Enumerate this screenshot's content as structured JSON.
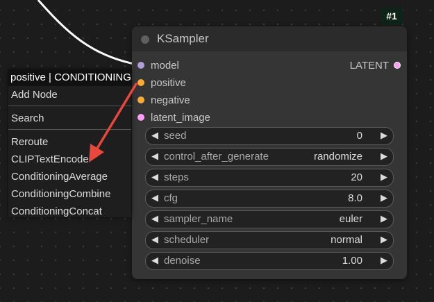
{
  "node": {
    "id_badge": "#1",
    "title": "KSampler",
    "inputs": [
      {
        "label": "model",
        "color": "#b39ddb"
      },
      {
        "label": "positive",
        "color": "#ffa931"
      },
      {
        "label": "negative",
        "color": "#ffa931"
      },
      {
        "label": "latent_image",
        "color": "#ff9cf9"
      }
    ],
    "output": {
      "label": "LATENT",
      "color": "#ff9cf9"
    },
    "widgets": [
      {
        "name": "seed",
        "value": "0"
      },
      {
        "name": "control_after_generate",
        "value": "randomize"
      },
      {
        "name": "steps",
        "value": "20"
      },
      {
        "name": "cfg",
        "value": "8.0"
      },
      {
        "name": "sampler_name",
        "value": "euler"
      },
      {
        "name": "scheduler",
        "value": "normal"
      },
      {
        "name": "denoise",
        "value": "1.00"
      }
    ],
    "arrow_left": "◀",
    "arrow_right": "▶"
  },
  "menu": {
    "title": "positive | CONDITIONING",
    "add_node": "Add Node",
    "search": "Search",
    "reroute": "Reroute",
    "items": [
      "CLIPTextEncode",
      "ConditioningAverage",
      "ConditioningCombine",
      "ConditioningConcat"
    ]
  },
  "colors": {
    "annotation_arrow": "#e8473c",
    "wire": "#ffffff"
  }
}
